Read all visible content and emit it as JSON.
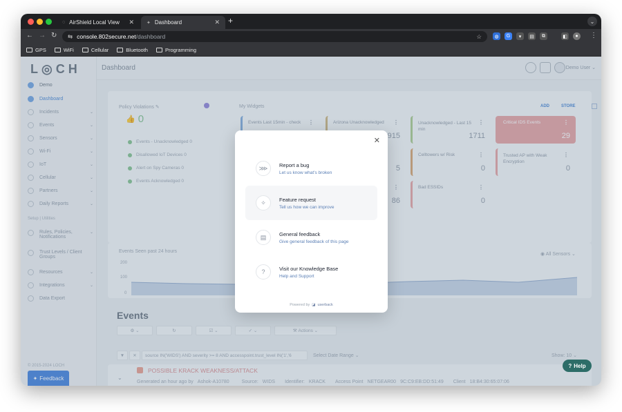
{
  "browser": {
    "tabs": [
      {
        "title": "AirShield Local View"
      },
      {
        "title": "Dashboard"
      }
    ],
    "url_host": "console.802secure.net",
    "url_path": "/dashboard",
    "bookmarks": [
      "GPS",
      "WiFi",
      "Cellular",
      "Bluetooth",
      "Programming"
    ]
  },
  "app": {
    "logo": "L◎CH",
    "page_title": "Dashboard",
    "user": "Demo User",
    "sidebar": {
      "org": "Demo",
      "items": [
        {
          "label": "Dashboard",
          "active": true
        },
        {
          "label": "Incidents"
        },
        {
          "label": "Events"
        },
        {
          "label": "Sensors"
        },
        {
          "label": "Wi-Fi"
        },
        {
          "label": "IoT"
        },
        {
          "label": "Cellular"
        },
        {
          "label": "Partners"
        },
        {
          "label": "Daily Reports"
        }
      ],
      "section": "Setup | Utilities",
      "utilities": [
        {
          "label": "Rules, Policies, Notifications"
        },
        {
          "label": "Trust Levels / Client Groups"
        },
        {
          "label": "Resources"
        },
        {
          "label": "Integrations"
        },
        {
          "label": "Data Export"
        }
      ],
      "copyright": "© 2015-2024 LOCH",
      "feedback": "Feedback"
    },
    "policy": {
      "title": "Policy Violations",
      "count": "0",
      "rows": [
        "Events - Unacknowledged 0",
        "Disallowed IoT Devices 0",
        "Alert on Spy Cameras 0",
        "Events Acknowledged 0"
      ]
    },
    "widgets": {
      "title": "My Widgets",
      "add": "ADD",
      "store": "STORE",
      "items": [
        {
          "label": "Events Last 15min - check",
          "value": ""
        },
        {
          "label": "Arizona Unacknowledged",
          "value": "915"
        },
        {
          "label": "Unacknowledged - Last 15 min",
          "value": "1711"
        },
        {
          "label": "Critical IDS Events",
          "value": "29"
        },
        {
          "label": "",
          "value": "5"
        },
        {
          "label": "Celltowers w/ Risk",
          "value": "0"
        },
        {
          "label": "Trusted AP with Weak Encryption",
          "value": "0"
        },
        {
          "label": "",
          "value": "86"
        },
        {
          "label": "Bad ESSIDs",
          "value": "0"
        }
      ]
    },
    "events_chart": {
      "title": "Events Seen past 24 hours",
      "filter": "All Sensors",
      "ticks": [
        "200",
        "100",
        "0"
      ]
    },
    "events": {
      "title": "Events",
      "actions": "Actions",
      "query": "source IN('WIDS') AND severity >= 8 AND accesspoint.trust_level IN('1','6",
      "date_range": "Select Date Range",
      "show_label": "Show",
      "show_value": "10",
      "row_title": "POSSIBLE KRACK WEAKNESS/ATTACK",
      "row_meta": "Generated an hour ago by",
      "row_sensor": "Ashok-A10780",
      "row_source_label": "Source:",
      "row_source": "WIDS",
      "row_identifier_label": "Identifier:",
      "row_identifier": "KRACK",
      "row_ap_label": "Access Point",
      "row_ap": "NETGEAR00",
      "row_mac": "9C:C9:EB:DD:51:49",
      "row_client_label": "Client",
      "row_client": "18:B4:30:65:07:06"
    },
    "help": "Help"
  },
  "modal": {
    "options": [
      {
        "title": "Report a bug",
        "subtitle": "Let us know what's broken",
        "icon": "bug-icon"
      },
      {
        "title": "Feature request",
        "subtitle": "Tell us how we can improve",
        "icon": "sparkle-icon"
      },
      {
        "title": "General feedback",
        "subtitle": "Give general feedback of this page",
        "icon": "document-icon"
      },
      {
        "title": "Visit our Knowledge Base",
        "subtitle": "Help and Support",
        "icon": "question-icon"
      }
    ],
    "powered_by": "Powered by",
    "brand": "userback"
  }
}
